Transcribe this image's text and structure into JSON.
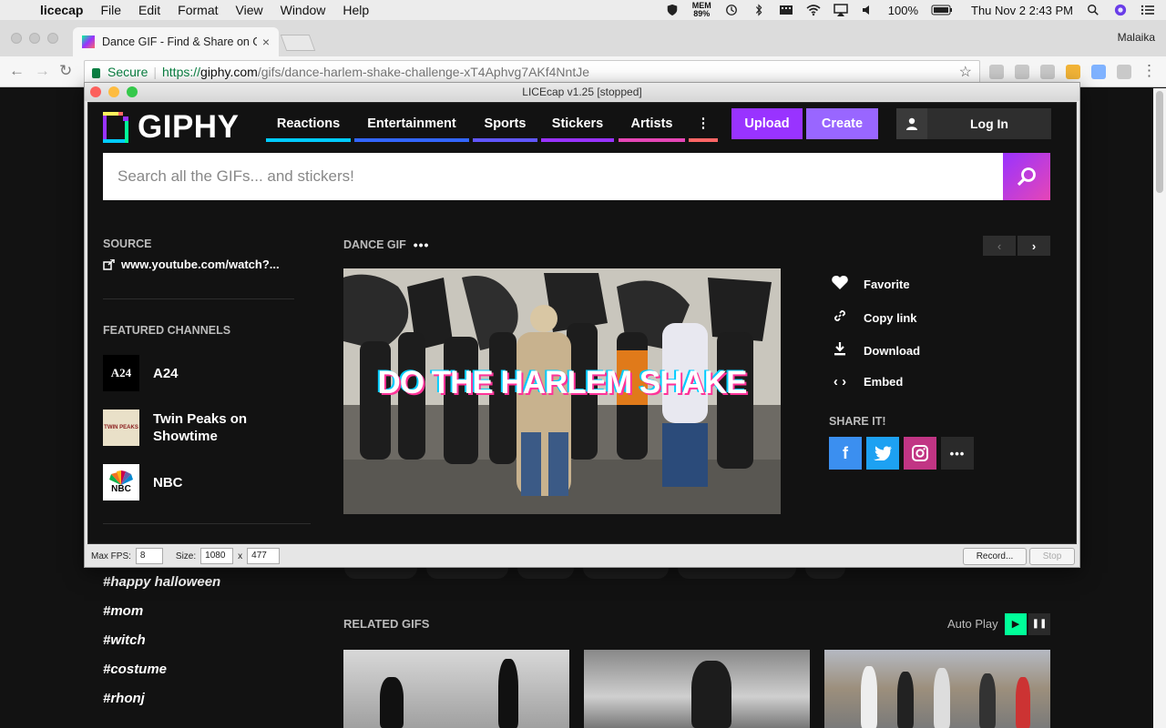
{
  "menubar": {
    "apple": "",
    "app": "licecap",
    "items": [
      "File",
      "Edit",
      "Format",
      "View",
      "Window",
      "Help"
    ],
    "mem_label": "MEM",
    "mem_value": "89%",
    "battery": "100%",
    "clock": "Thu Nov 2  2:43 PM"
  },
  "browser": {
    "tab_title": "Dance GIF - Find & Share on GIPHY",
    "tab_close": "×",
    "profile": "Malaika",
    "secure_label": "Secure",
    "url_scheme": "https://",
    "url_host": "giphy.com",
    "url_path": "/gifs/dance-harlem-shake-challenge-xT4Aphvg7AKf4NntJe",
    "star": "☆"
  },
  "licecap": {
    "title": "LICEcap v1.25 [stopped]",
    "fps_label": "Max FPS:",
    "fps_value": "8",
    "size_label": "Size:",
    "width_value": "1080",
    "size_x": "x",
    "height_value": "477",
    "record_label": "Record...",
    "stop_label": "Stop"
  },
  "giphy": {
    "logo_text": "GIPHY",
    "nav": [
      {
        "label": "Reactions",
        "color": "#00ccff"
      },
      {
        "label": "Entertainment",
        "color": "#3366ff"
      },
      {
        "label": "Sports",
        "color": "#6157ff"
      },
      {
        "label": "Stickers",
        "color": "#9933ff"
      },
      {
        "label": "Artists",
        "color": "#e646b6"
      }
    ],
    "more_color": "#ff6666",
    "upload_label": "Upload",
    "create_label": "Create",
    "login_label": "Log In",
    "search_placeholder": "Search all the GIFs... and stickers!",
    "source_label": "SOURCE",
    "source_link": "www.youtube.com/watch?...",
    "featured_label": "FEATURED CHANNELS",
    "channels": [
      {
        "name": "A24",
        "avatar": "A24"
      },
      {
        "name": "Twin Peaks on Showtime",
        "avatar": "TWIN PEAKS"
      },
      {
        "name": "NBC",
        "avatar": "NBC"
      }
    ],
    "gif_title": "DANCE GIF",
    "gif_caption": "DO THE HARLEM SHAKE",
    "actions": [
      {
        "label": "Favorite",
        "icon": "heart-icon"
      },
      {
        "label": "Copy link",
        "icon": "link-icon"
      },
      {
        "label": "Download",
        "icon": "download-icon"
      },
      {
        "label": "Embed",
        "icon": "code-icon"
      }
    ],
    "share_label": "SHARE IT!",
    "share_colors": {
      "facebook": "#3b8ff0",
      "twitter": "#1da1f2",
      "instagram": "#c13584",
      "more": "#2a2a2a"
    },
    "tags": [
      "#happy halloween",
      "#mom",
      "#witch",
      "#costume",
      "#rhonj"
    ],
    "related_label": "RELATED GIFS",
    "autoplay_label": "Auto Play"
  }
}
